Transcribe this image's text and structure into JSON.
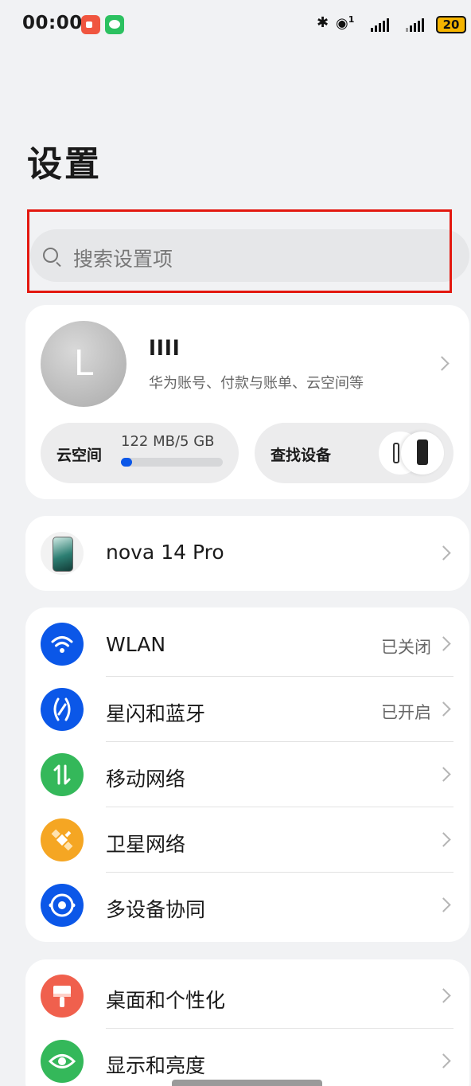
{
  "status_bar": {
    "time": "00:00",
    "indicators": [
      "screen-record-icon",
      "wechat-icon"
    ],
    "icons": [
      "bluetooth-icon",
      "hotspot-icon",
      "signal-icon",
      "signal-icon",
      "battery-icon"
    ],
    "hotspot_count": "1",
    "battery": "20"
  },
  "page": {
    "title": "设置"
  },
  "search": {
    "placeholder": "搜索设置项"
  },
  "account": {
    "avatar_letter": "L",
    "name": "llll",
    "subtitle": "华为账号、付款与账单、云空间等",
    "cloud": {
      "label": "云空间",
      "usage": "122 MB/5 GB",
      "used_fraction": 0.024
    },
    "find_device": {
      "label": "查找设备"
    }
  },
  "device": {
    "name": "nova 14 Pro"
  },
  "connectivity": [
    {
      "label": "WLAN",
      "status": "已关闭",
      "icon": "wifi-icon",
      "color": "#0b57e8"
    },
    {
      "label": "星闪和蓝牙",
      "status": "已开启",
      "icon": "nearlink-bluetooth-icon",
      "color": "#0b57e8"
    },
    {
      "label": "移动网络",
      "status": "",
      "icon": "mobile-data-icon",
      "color": "#34b85a"
    },
    {
      "label": "卫星网络",
      "status": "",
      "icon": "satellite-icon",
      "color": "#f5a623"
    },
    {
      "label": "多设备协同",
      "status": "",
      "icon": "multi-device-icon",
      "color": "#0b57e8"
    }
  ],
  "personalization": [
    {
      "label": "桌面和个性化",
      "icon": "paintbrush-icon",
      "color": "#f0604d"
    },
    {
      "label": "显示和亮度",
      "icon": "eye-icon",
      "color": "#34b85a"
    }
  ],
  "colors": {
    "accent": "#0b57e8",
    "highlight_box": "#e3180f",
    "background": "#f1f2f4"
  }
}
